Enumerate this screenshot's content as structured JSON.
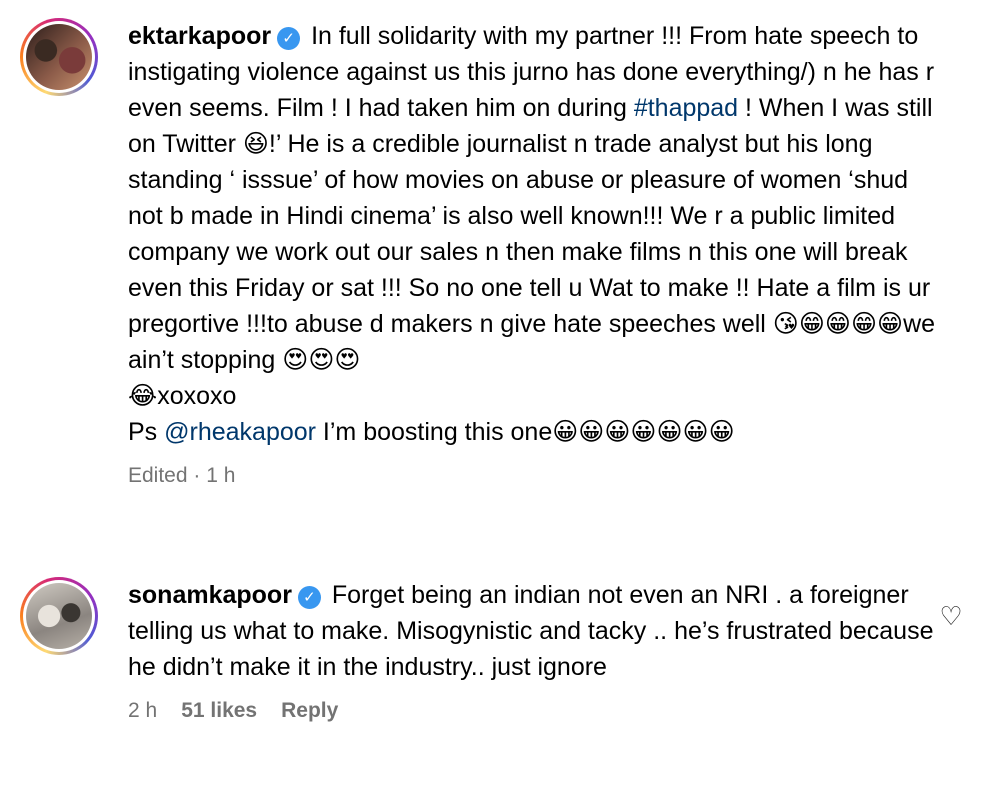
{
  "comments": [
    {
      "username": "ektarkapoor",
      "verified": "✓",
      "text_before_tag": " In full solidarity with my partner !!! From hate speech to instigating violence against us this jurno has done everything/) n he has r even seems. Film ! I had taken him on during ",
      "hashtag": "#thappad",
      "text_after_tag": " ! When I was still on Twitter 😆!’ He is a credible journalist n trade analyst but his long standing ‘ isssue’ of how movies on abuse or pleasure of women ‘shud not b made in Hindi cinema’ is also well known!!! We r a public limited company we work out our sales n then make films n this one will break even this Friday or sat !!! So no one tell u Wat to make !! Hate a film is ur pregortive !!!to abuse d makers n give hate speeches well 😘😁😁😁😁we ain’t stopping 😍😍😍\n😂xoxoxo\nPs ",
      "mention": "@rheakapoor",
      "text_after_mention": " I’m boosting this one😀😀😀😀😀😀😀",
      "meta": {
        "edited": "Edited · 1 h"
      }
    },
    {
      "username": "sonamkapoor",
      "verified": "✓",
      "text": " Forget being an indian not even an NRI . a foreigner telling us what to make. Misogynistic and tacky .. he’s frustrated because he didn’t make it in the industry.. just ignore",
      "meta": {
        "time": "2 h",
        "likes": "51 likes",
        "reply": "Reply"
      },
      "like_icon": "♡"
    }
  ]
}
